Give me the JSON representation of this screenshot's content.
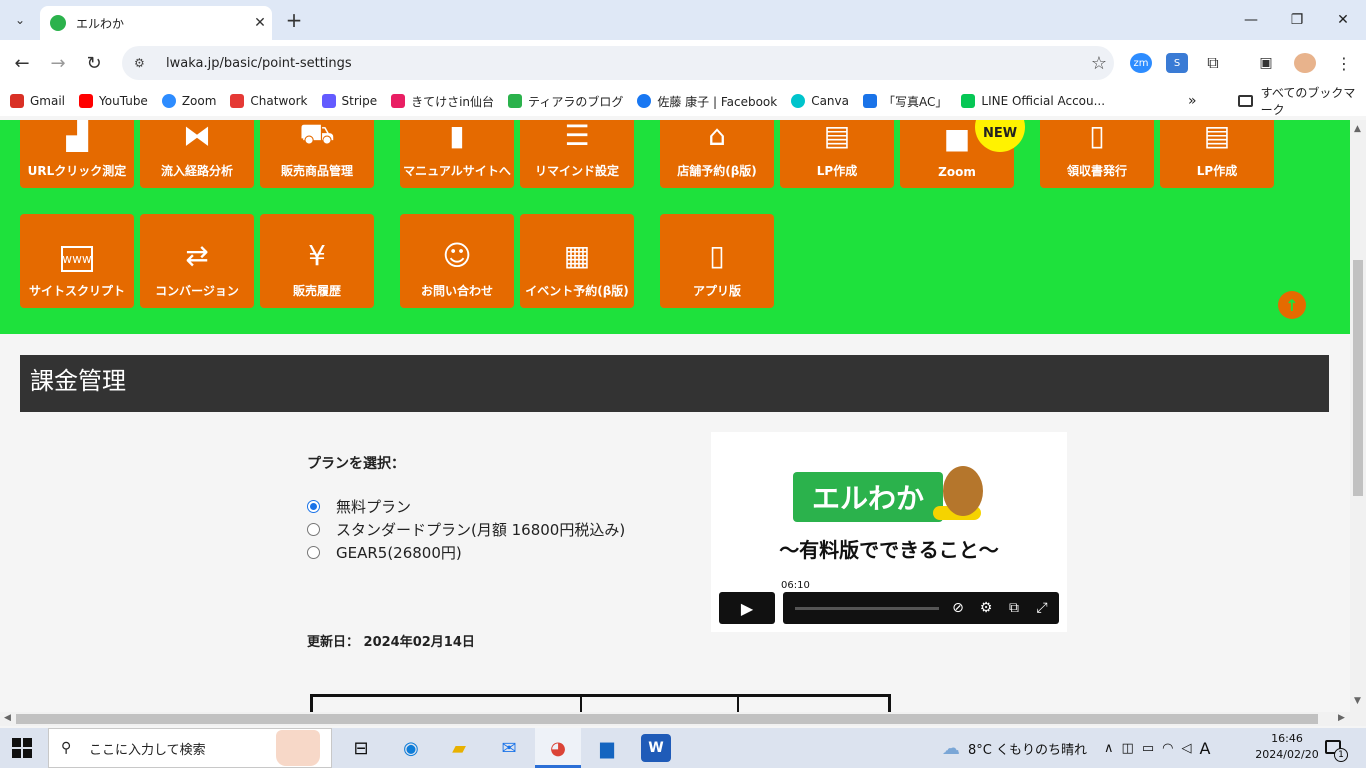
{
  "browser": {
    "tab_title": "エルわか",
    "url": "lwaka.jp/basic/point-settings",
    "bookmarks": [
      {
        "label": "Gmail",
        "color": "#d93025"
      },
      {
        "label": "YouTube",
        "color": "#ff0000"
      },
      {
        "label": "Zoom",
        "color": "#2d8cff"
      },
      {
        "label": "Chatwork",
        "color": "#e53935"
      },
      {
        "label": "Stripe",
        "color": "#635bff"
      },
      {
        "label": "きてけさin仙台",
        "color": "#e91e63"
      },
      {
        "label": "ティアラのブログ",
        "color": "#2bb24c"
      },
      {
        "label": "佐藤 康子 | Facebook",
        "color": "#1877f2"
      },
      {
        "label": "Canva",
        "color": "#00c4cc"
      },
      {
        "label": "「写真AC」",
        "color": "#1a73e8"
      },
      {
        "label": "LINE Official Accou...",
        "color": "#06c755"
      }
    ],
    "all_bookmarks": "すべてのブックマーク"
  },
  "menu_tiles": [
    {
      "label": "URLクリック測定",
      "icon": "chart-search-icon"
    },
    {
      "label": "流入経路分析",
      "icon": "sitemap-icon"
    },
    {
      "label": "販売商品管理",
      "icon": "cart-icon"
    },
    {
      "label": "マニュアルサイトへ",
      "icon": "book-icon"
    },
    {
      "label": "リマインド設定",
      "icon": "list-icon"
    },
    {
      "label": "店舗予約(β版)",
      "icon": "store-icon"
    },
    {
      "label": "LP作成",
      "icon": "browser-image-icon"
    },
    {
      "label": "Zoom",
      "icon": "video-camera-icon"
    },
    {
      "label": "領収書発行",
      "icon": "receipt-icon"
    },
    {
      "label": "LP作成",
      "icon": "browser-image-icon"
    },
    {
      "label": "サイトスクリプト",
      "icon": "www-icon"
    },
    {
      "label": "コンバージョン",
      "icon": "exchange-icon"
    },
    {
      "label": "販売履歴",
      "icon": "yen-bag-icon"
    },
    {
      "label": "お問い合わせ",
      "icon": "headset-icon"
    },
    {
      "label": "イベント予約(β版)",
      "icon": "calendar-icon"
    },
    {
      "label": "アプリ版",
      "icon": "smartphone-icon"
    }
  ],
  "new_badge": "NEW",
  "section_title": "課金管理",
  "plan": {
    "label": "プランを選択：",
    "options": [
      "無料プラン",
      "スタンダードプラン(月額 16800円税込み)",
      "GEAR5(26800円)"
    ],
    "selected": "無料プラン"
  },
  "updated_text": "更新日： 2024年02月14日",
  "video": {
    "logo_text": "エルわか",
    "subtitle": "〜有料版でできること〜",
    "time": "06:10"
  },
  "taskbar": {
    "search_placeholder": "ここに入力して検索",
    "weather": "8°C くもりのち晴れ",
    "ime": "A",
    "time": "16:46",
    "date": "2024/02/20",
    "notification_count": "1"
  },
  "colors": {
    "accent_green": "#1ee13c",
    "tile_orange": "#e56a00",
    "header_dark": "#333333",
    "brand_green": "#2bb24c"
  }
}
